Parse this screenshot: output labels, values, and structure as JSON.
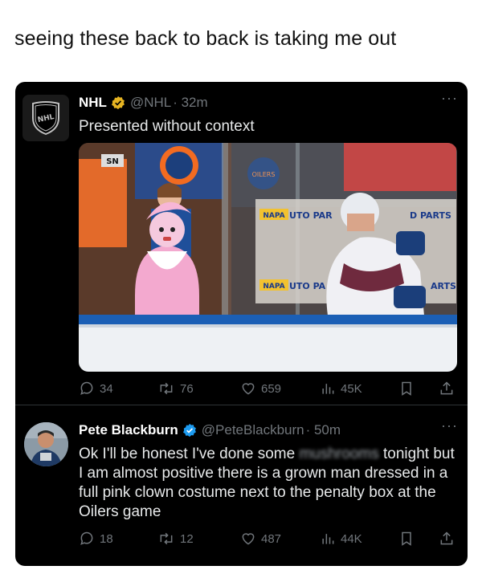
{
  "caption": "seeing these back to back is taking me out",
  "tweets": [
    {
      "name": "NHL",
      "handle": "@NHL",
      "time": "· 32m",
      "text": "Presented without context",
      "replies": "34",
      "reposts": "76",
      "likes": "659",
      "views": "45K",
      "more": "···",
      "media_labels": [
        "SN",
        "NAPA",
        "UTO PAR",
        "D PARTS",
        "NAPA",
        "UTO PA",
        "ARTS",
        "OILERS"
      ]
    },
    {
      "name": "Pete Blackburn",
      "handle": "@PeteBlackburn",
      "time": "· 50m",
      "text_before": "Ok I'll be honest I've done some ",
      "text_blurred": "mushrooms",
      "text_after": " tonight but I am almost positive there is a grown man dressed in a full pink clown costume next to the penalty box at the Oilers game",
      "replies": "18",
      "reposts": "12",
      "likes": "487",
      "views": "44K",
      "more": "···"
    }
  ],
  "colors": {
    "verified": "#e6b422",
    "muted": "#71767b",
    "text": "#e7e9ea",
    "card": "#000000"
  }
}
